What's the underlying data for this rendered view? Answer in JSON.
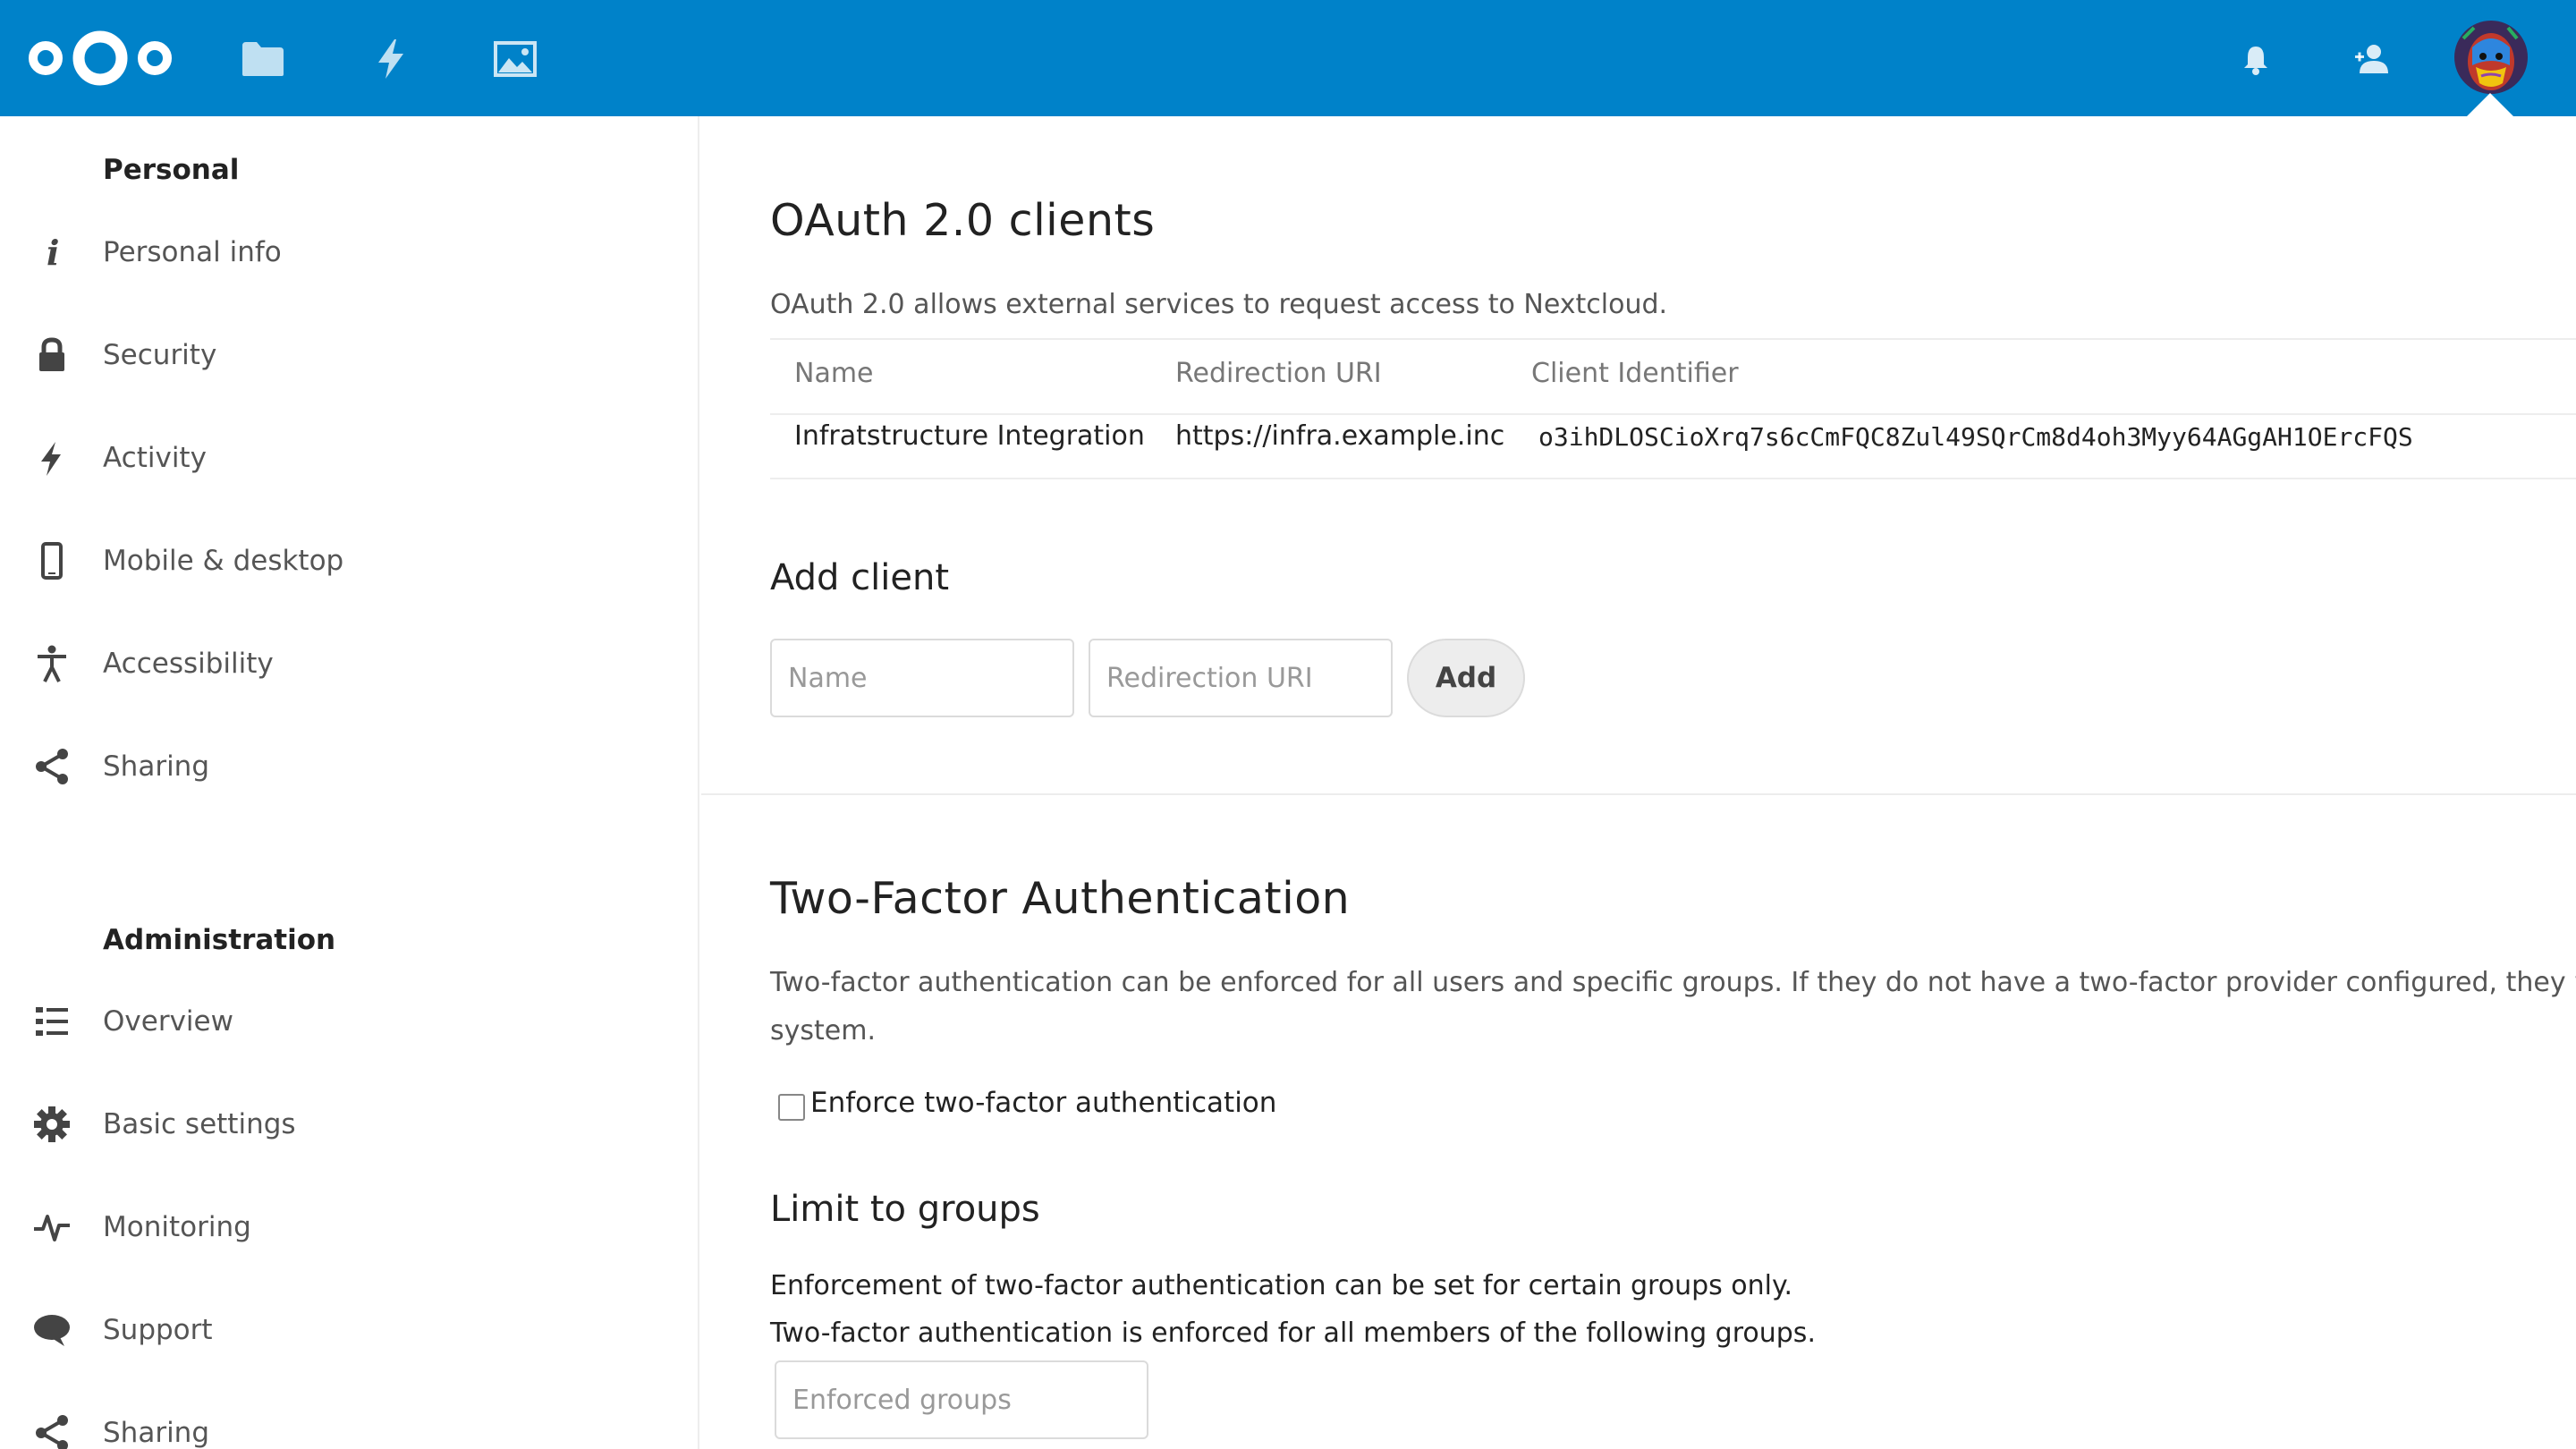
{
  "header": {
    "brand_color": "#0082c9",
    "apps": [
      {
        "name": "files",
        "icon": "folder-icon"
      },
      {
        "name": "activity",
        "icon": "lightning-icon"
      },
      {
        "name": "gallery",
        "icon": "image-icon"
      }
    ],
    "right_icons": [
      "bell-icon",
      "contacts-icon"
    ],
    "avatar": "user-avatar"
  },
  "sidebar": {
    "personal_title": "Personal",
    "personal_items": [
      {
        "label": "Personal info",
        "icon": "info-icon"
      },
      {
        "label": "Security",
        "icon": "lock-icon"
      },
      {
        "label": "Activity",
        "icon": "lightning-icon"
      },
      {
        "label": "Mobile & desktop",
        "icon": "phone-icon"
      },
      {
        "label": "Accessibility",
        "icon": "accessibility-icon"
      },
      {
        "label": "Sharing",
        "icon": "share-icon"
      }
    ],
    "admin_title": "Administration",
    "admin_items": [
      {
        "label": "Overview",
        "icon": "list-icon"
      },
      {
        "label": "Basic settings",
        "icon": "gear-icon"
      },
      {
        "label": "Monitoring",
        "icon": "pulse-icon"
      },
      {
        "label": "Support",
        "icon": "speech-bubble-icon"
      },
      {
        "label": "Sharing",
        "icon": "share-icon"
      }
    ]
  },
  "oauth": {
    "title": "OAuth 2.0 clients",
    "description": "OAuth 2.0 allows external services to request access to Nextcloud.",
    "columns": [
      "Name",
      "Redirection URI",
      "Client Identifier"
    ],
    "rows": [
      {
        "name": "Infratstructure Integration",
        "redirect_uri": "https://infra.example.inc",
        "client_id": "o3ihDLOSCioXrq7s6cCmFQC8Zul49SQrCm8d4oh3Myy64AGgAH1OErcFQS"
      }
    ],
    "add_client_title": "Add client",
    "name_placeholder": "Name",
    "uri_placeholder": "Redirection URI",
    "add_button": "Add"
  },
  "twofactor": {
    "title": "Two-Factor Authentication",
    "description_line1": "Two-factor authentication can be enforced for all users and specific groups. If they do not have a two-factor provider configured, they wi",
    "description_line2": "system.",
    "enforce_label": "Enforce two-factor authentication",
    "enforce_checked": false,
    "limit_title": "Limit to groups",
    "limit_line1": "Enforcement of two-factor authentication can be set for certain groups only.",
    "limit_line2": "Two-factor authentication is enforced for all members of the following groups.",
    "groups_placeholder": "Enforced groups"
  }
}
